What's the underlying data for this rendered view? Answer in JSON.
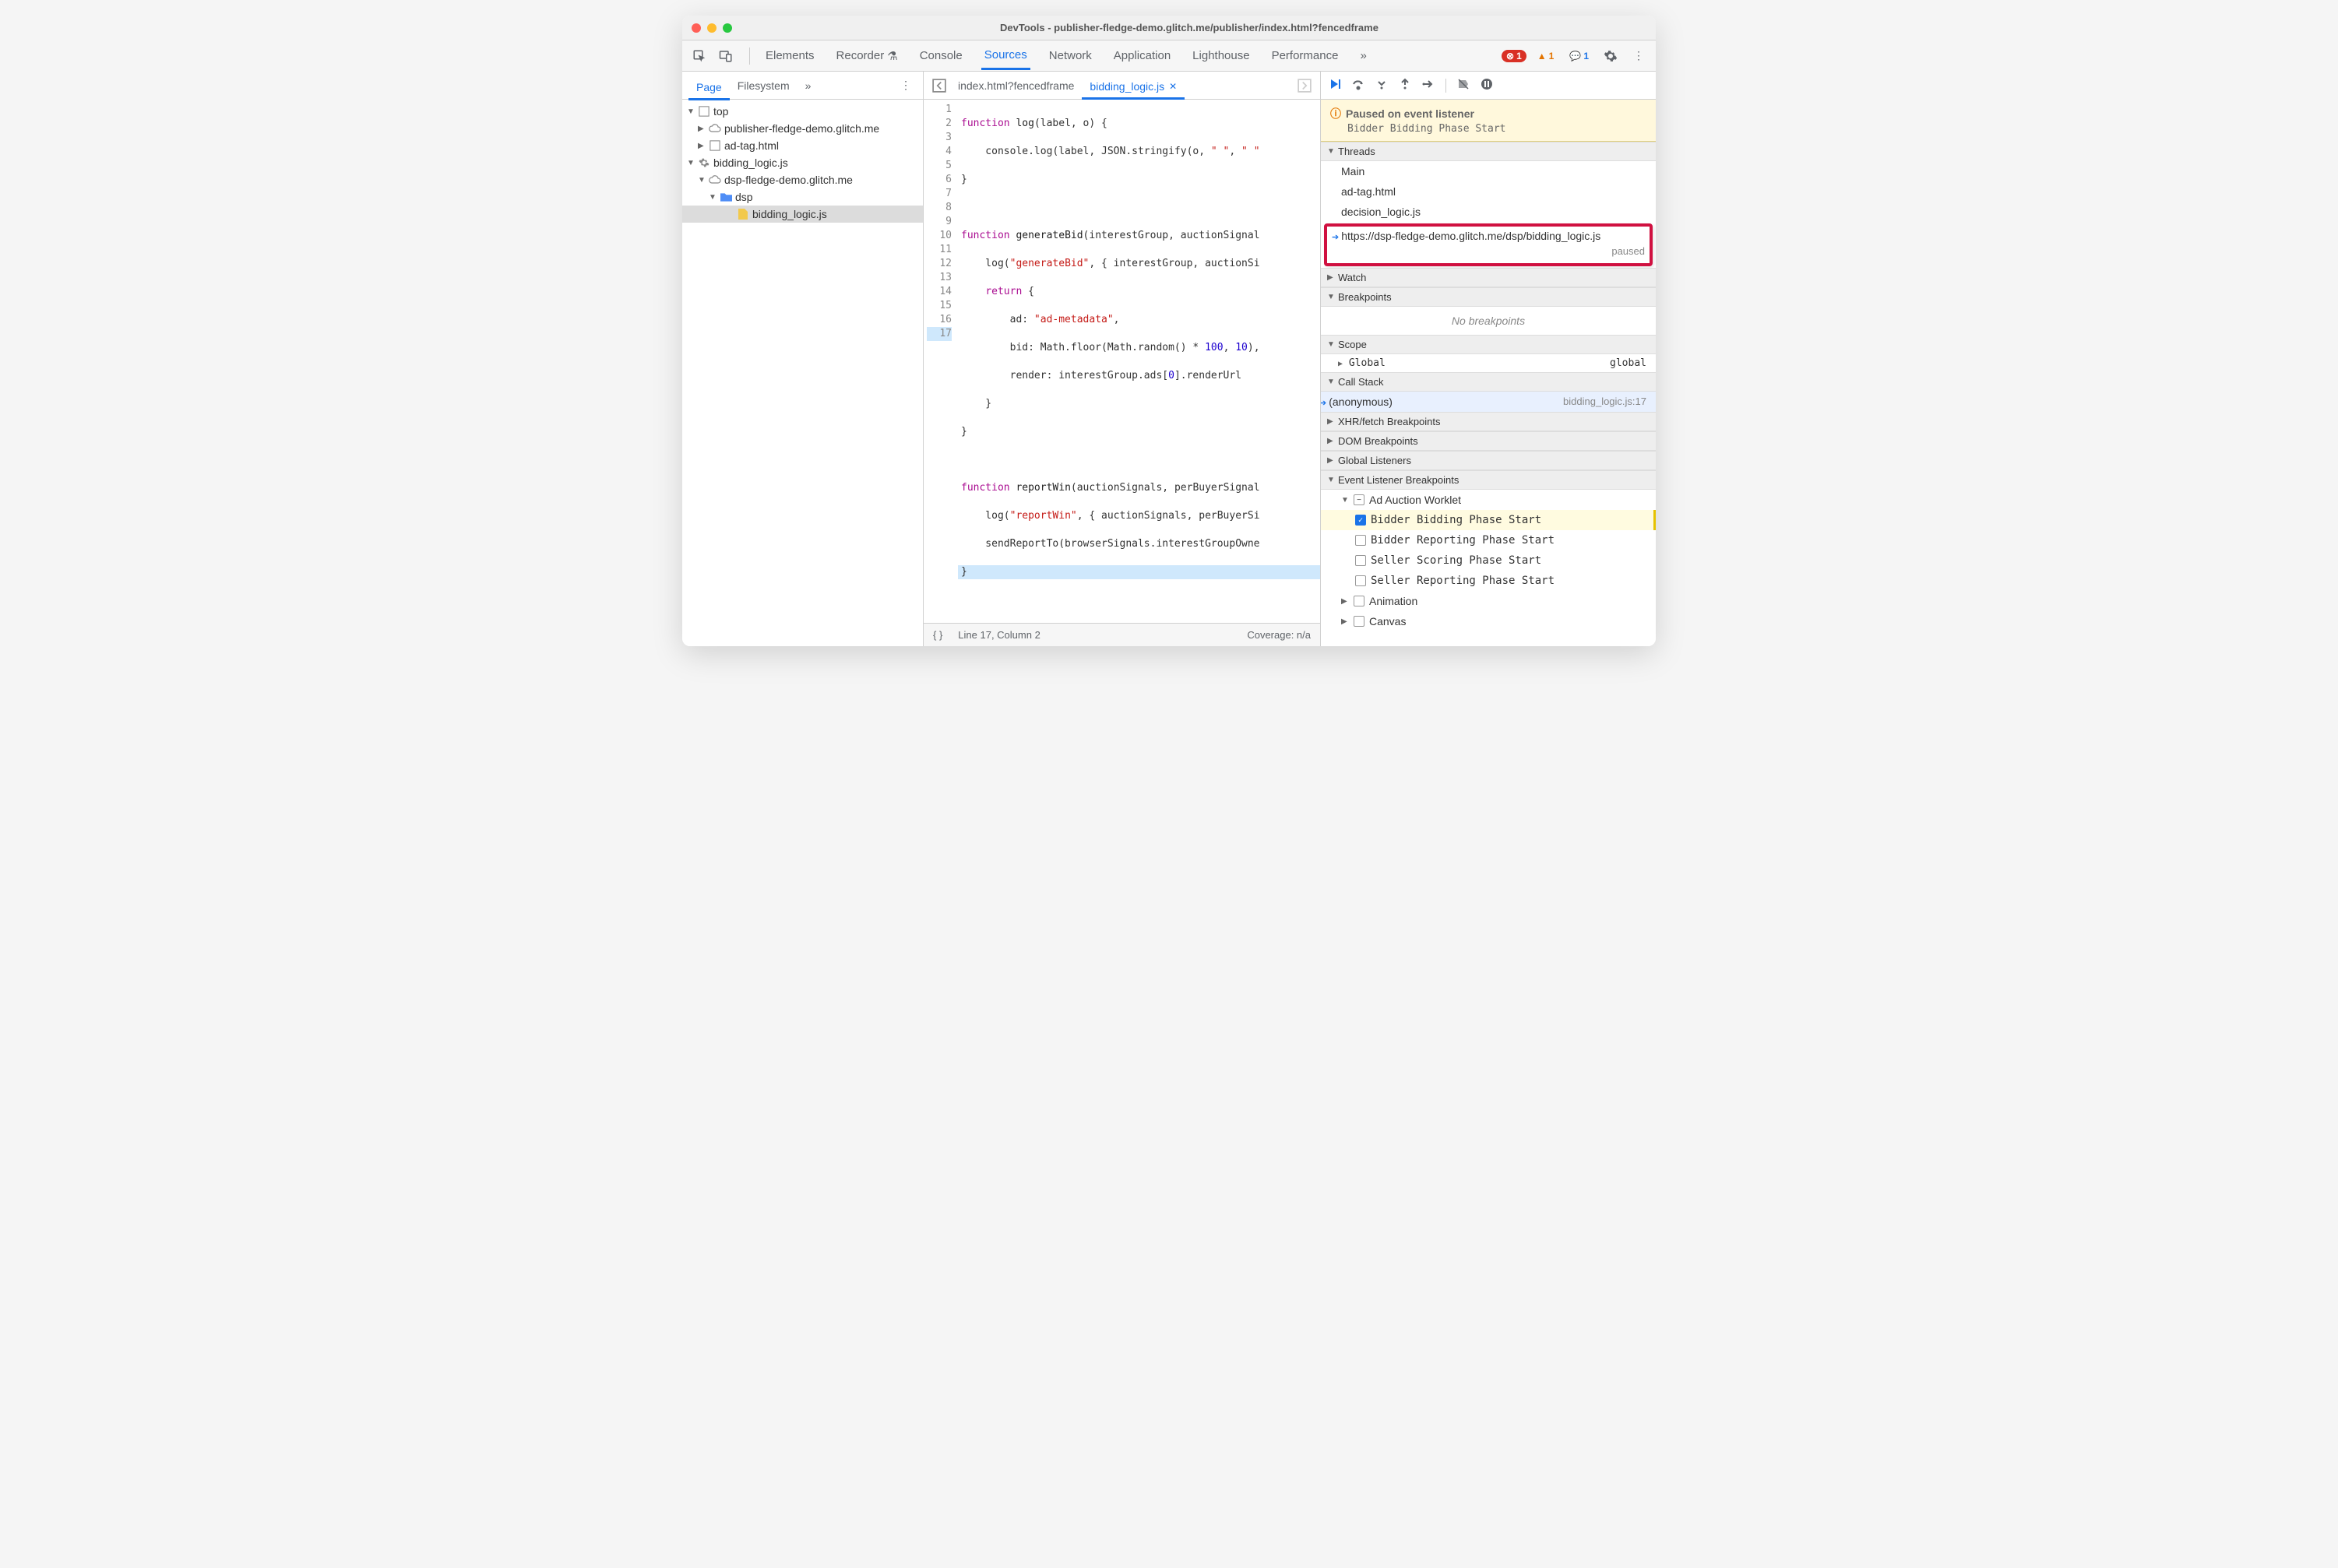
{
  "title": "DevTools - publisher-fledge-demo.glitch.me/publisher/index.html?fencedframe",
  "tabs": [
    "Elements",
    "Recorder",
    "Console",
    "Sources",
    "Network",
    "Application",
    "Lighthouse",
    "Performance"
  ],
  "activeTab": "Sources",
  "badges": {
    "errors": "1",
    "warnings": "1",
    "messages": "1"
  },
  "navTabs": [
    "Page",
    "Filesystem"
  ],
  "activeNavTab": "Page",
  "tree": {
    "top": "top",
    "domain1": "publisher-fledge-demo.glitch.me",
    "adtag": "ad-tag.html",
    "bidding": "bidding_logic.js",
    "domain2": "dsp-fledge-demo.glitch.me",
    "dsp": "dsp",
    "file": "bidding_logic.js"
  },
  "editorTabs": [
    {
      "label": "index.html?fencedframe",
      "active": false
    },
    {
      "label": "bidding_logic.js",
      "active": true,
      "closable": true
    }
  ],
  "lineCount": 17,
  "status": {
    "line": "Line 17, Column 2",
    "coverage": "Coverage: n/a"
  },
  "paused": {
    "title": "Paused on event listener",
    "sub": "Bidder Bidding Phase Start"
  },
  "threads": {
    "heading": "Threads",
    "items": [
      "Main",
      "ad-tag.html",
      "decision_logic.js"
    ],
    "highlighted": "https://dsp-fledge-demo.glitch.me/dsp/bidding_logic.js",
    "highlightedStatus": "paused"
  },
  "sections": {
    "watch": "Watch",
    "breakpoints": "Breakpoints",
    "noBreakpoints": "No breakpoints",
    "scope": "Scope",
    "global": "Global",
    "globalVal": "global",
    "callStack": "Call Stack",
    "callAnon": "(anonymous)",
    "callLoc": "bidding_logic.js:17",
    "xhr": "XHR/fetch Breakpoints",
    "dom": "DOM Breakpoints",
    "glisteners": "Global Listeners",
    "evl": "Event Listener Breakpoints",
    "adAuction": "Ad Auction Worklet",
    "bp1": "Bidder Bidding Phase Start",
    "bp2": "Bidder Reporting Phase Start",
    "bp3": "Seller Scoring Phase Start",
    "bp4": "Seller Reporting Phase Start",
    "anim": "Animation",
    "canvas": "Canvas"
  }
}
